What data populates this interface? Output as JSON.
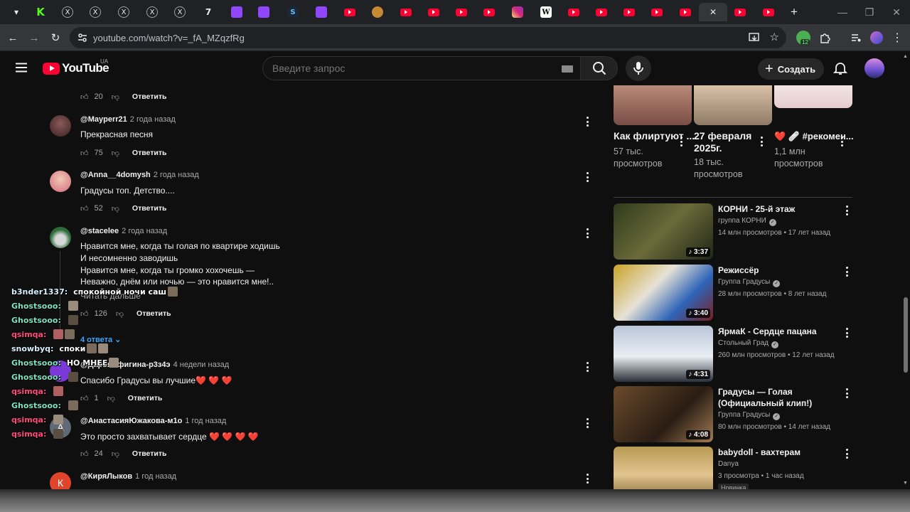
{
  "browser": {
    "url": "youtube.com/watch?v=_fA_MZqzfRg",
    "tabs": [
      {
        "icon": "chevron-down-icon",
        "label": "▾"
      },
      {
        "icon": "kick-favicon",
        "label": "K"
      },
      {
        "icon": "x-favicon",
        "label": "X"
      },
      {
        "icon": "x-favicon",
        "label": "X"
      },
      {
        "icon": "x-favicon",
        "label": "X"
      },
      {
        "icon": "x-favicon",
        "label": "X"
      },
      {
        "icon": "x-favicon",
        "label": "X"
      },
      {
        "icon": "7tv-favicon",
        "label": "7"
      },
      {
        "icon": "twitch-favicon",
        "label": ""
      },
      {
        "icon": "twitch-favicon",
        "label": ""
      },
      {
        "icon": "steam-favicon",
        "label": "S"
      },
      {
        "icon": "twitch-favicon",
        "label": ""
      },
      {
        "icon": "youtube-favicon",
        "label": ""
      },
      {
        "icon": "misc-favicon",
        "label": ""
      },
      {
        "icon": "youtube-favicon",
        "label": ""
      },
      {
        "icon": "youtube-favicon",
        "label": ""
      },
      {
        "icon": "youtube-favicon",
        "label": ""
      },
      {
        "icon": "youtube-favicon",
        "label": ""
      },
      {
        "icon": "instagram-favicon",
        "label": ""
      },
      {
        "icon": "wikipedia-favicon",
        "label": "W"
      },
      {
        "icon": "youtube-favicon",
        "label": ""
      },
      {
        "icon": "youtube-favicon",
        "label": ""
      },
      {
        "icon": "youtube-favicon",
        "label": ""
      },
      {
        "icon": "youtube-favicon",
        "label": ""
      },
      {
        "icon": "youtube-favicon",
        "label": ""
      },
      {
        "icon": "close-icon",
        "label": "✕"
      },
      {
        "icon": "youtube-favicon",
        "label": ""
      },
      {
        "icon": "youtube-favicon",
        "label": ""
      },
      {
        "icon": "new-tab-icon",
        "label": "+"
      }
    ],
    "extension_badge": "12"
  },
  "youtube": {
    "logo_text": "YouTube",
    "region": "UA",
    "search_placeholder": "Введите запрос",
    "create_label": "Создать"
  },
  "comments": [
    {
      "author": "",
      "time": "",
      "lines": [],
      "likes": "20",
      "reply": "Ответить"
    },
    {
      "author": "@Mayperr21",
      "time": "2 года назад",
      "lines": [
        "Прекрасная песня"
      ],
      "likes": "75",
      "reply": "Ответить"
    },
    {
      "author": "@Anna__4domysh",
      "time": "2 года назад",
      "lines": [
        "Градусы топ. Детство...."
      ],
      "likes": "52",
      "reply": "Ответить"
    },
    {
      "author": "@stacelee",
      "time": "2 года назад",
      "lines": [
        "Нравится мне, когда ты голая по квартире ходишь",
        "И несомненно заводишь",
        "Нравится мне, когда ты громко хохочешь —",
        "Неважно, днём или ночью — это нравится мне!.."
      ],
      "read_more": "Читать дальше",
      "likes": "126",
      "reply": "Ответить",
      "replies": "4 ответа"
    },
    {
      "author": "@ДарьяЕфигина-р3з4э",
      "time": "4 недели назад",
      "lines": [
        "Спасибо Градусы вы лучшие❤️ ❤️ ❤️"
      ],
      "likes": "1",
      "reply": "Ответить"
    },
    {
      "author": "@АнастасияЮжакова-м1о",
      "time": "1 год назад",
      "lines": [
        "Это просто захватывает сердце ❤️ ❤️ ❤️ ❤️"
      ],
      "likes": "24",
      "reply": "Ответить",
      "avatar_letter": "А"
    },
    {
      "author": "@КиряЛыков",
      "time": "1 год назад",
      "lines": [],
      "avatar_letter": "К"
    }
  ],
  "shelf": [
    {
      "title": "Как флиртуют ...",
      "views": "57 тыс. просмотров"
    },
    {
      "title": "27 февраля 2025г.",
      "views": "18 тыс. просмотров"
    },
    {
      "title": "❤️ 🩹 #рекомен...",
      "views": "1,1 млн просмотров"
    }
  ],
  "videos": [
    {
      "title": "КОРНИ - 25-й этаж",
      "channel": "группа КОРНИ",
      "meta": "14 млн просмотров • 17 лет назад",
      "duration": "3:37"
    },
    {
      "title": "Режиссёр",
      "channel": "Группа Градусы",
      "meta": "28 млн просмотров • 8 лет назад",
      "duration": "3:40"
    },
    {
      "title": "ЯрмаК - Сердце пацана",
      "channel": "Стольный Град",
      "meta": "260 млн просмотров • 12 лет назад",
      "duration": "4:31"
    },
    {
      "title": "Градусы — Голая (Официальный клип!)",
      "channel": "Группа Градусы",
      "meta": "80 млн просмотров • 14 лет назад",
      "duration": "4:08"
    },
    {
      "title": "babydoll - вахтерам",
      "channel": "Danya",
      "meta": "3 просмотра • 1 час назад",
      "badge": "Новинка"
    }
  ],
  "chat": [
    {
      "user": "b3nder1337:",
      "color": "#d8f0ff",
      "text": "спокойной ночи саш"
    },
    {
      "user": "Ghostsooo:",
      "color": "#7fe3c2",
      "text": ""
    },
    {
      "user": "Ghostsooo:",
      "color": "#7fe3c2",
      "text": ""
    },
    {
      "user": "qsimqa:",
      "color": "#ff4b7d",
      "text": ""
    },
    {
      "user": "snowbyq:",
      "color": "#d8f0ff",
      "text": "споки"
    },
    {
      "user": "Ghostsooo:",
      "color": "#7fe3c2",
      "text": "НО МНЕЕ"
    },
    {
      "user": "Ghostsooo:",
      "color": "#7fe3c2",
      "text": ""
    },
    {
      "user": "qsimqa:",
      "color": "#ff4b7d",
      "text": ""
    },
    {
      "user": "Ghostsooo:",
      "color": "#7fe3c2",
      "text": ""
    },
    {
      "user": "qsimqa:",
      "color": "#ff4b7d",
      "text": ""
    },
    {
      "user": "qsimqa:",
      "color": "#ff4b7d",
      "text": ""
    }
  ]
}
